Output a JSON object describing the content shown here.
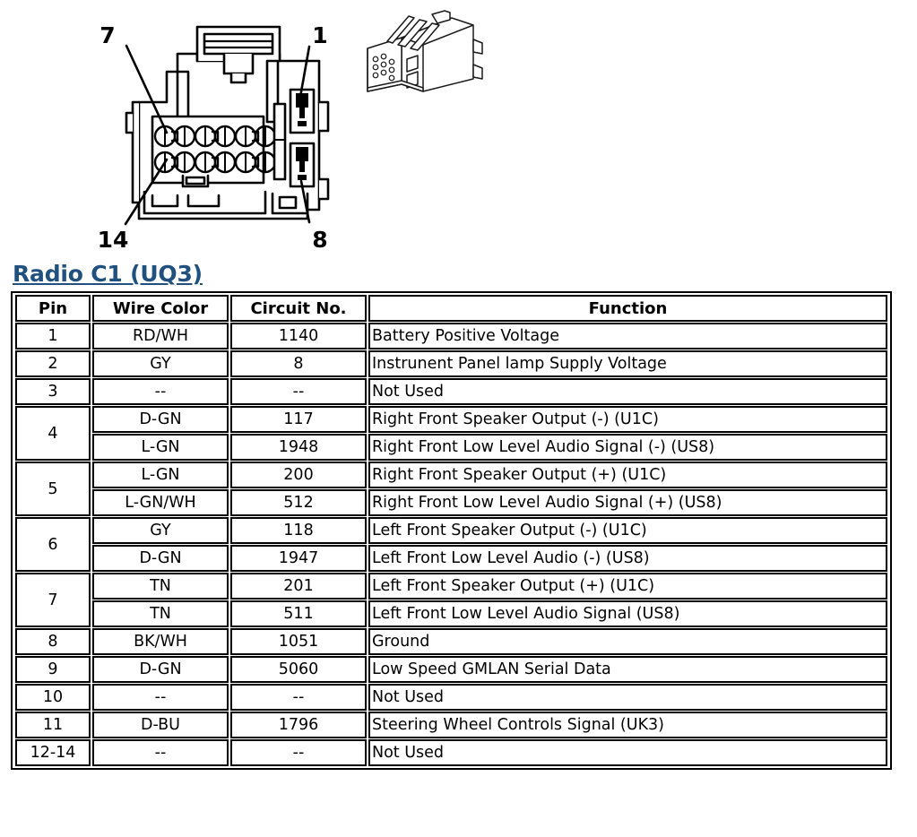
{
  "diagram": {
    "name": "radio-c1-connector-face-view",
    "description": "Front view of 14-cavity radio harness connector with pin-number callouts",
    "callouts": [
      {
        "label": "7",
        "position": "top-left"
      },
      {
        "label": "1",
        "position": "top-right"
      },
      {
        "label": "14",
        "position": "bottom-left"
      },
      {
        "label": "8",
        "position": "bottom-right"
      }
    ],
    "iso_view_name": "connector-isometric-view"
  },
  "heading": {
    "title": "Radio C1 (UQ3)",
    "color": "#20507d"
  },
  "table": {
    "name": "radio-c1-pinout-table",
    "headers": {
      "pin": "Pin",
      "wire_color": "Wire Color",
      "circuit_no": "Circuit No.",
      "function": "Function"
    },
    "rows": [
      {
        "pin": "1",
        "lines": [
          {
            "wire_color": "RD/WH",
            "circuit_no": "1140",
            "function": "Battery Positive Voltage"
          }
        ]
      },
      {
        "pin": "2",
        "lines": [
          {
            "wire_color": "GY",
            "circuit_no": "8",
            "function": "Instrunent Panel lamp Supply Voltage"
          }
        ]
      },
      {
        "pin": "3",
        "lines": [
          {
            "wire_color": "--",
            "circuit_no": "--",
            "function": "Not Used"
          }
        ]
      },
      {
        "pin": "4",
        "lines": [
          {
            "wire_color": "D-GN",
            "circuit_no": "117",
            "function": "Right Front Speaker Output (-) (U1C)"
          },
          {
            "wire_color": "L-GN",
            "circuit_no": "1948",
            "function": "Right Front Low Level Audio Signal (-) (US8)"
          }
        ]
      },
      {
        "pin": "5",
        "lines": [
          {
            "wire_color": "L-GN",
            "circuit_no": "200",
            "function": "Right Front Speaker Output (+) (U1C)"
          },
          {
            "wire_color": "L-GN/WH",
            "circuit_no": "512",
            "function": "Right Front Low Level Audio Signal (+) (US8)"
          }
        ]
      },
      {
        "pin": "6",
        "lines": [
          {
            "wire_color": "GY",
            "circuit_no": "118",
            "function": "Left Front Speaker Output (-) (U1C)"
          },
          {
            "wire_color": "D-GN",
            "circuit_no": "1947",
            "function": "Left Front Low Level Audio (-) (US8)"
          }
        ]
      },
      {
        "pin": "7",
        "lines": [
          {
            "wire_color": "TN",
            "circuit_no": "201",
            "function": "Left Front Speaker Output (+) (U1C)"
          },
          {
            "wire_color": "TN",
            "circuit_no": "511",
            "function": "Left Front Low Level Audio Signal (US8)"
          }
        ]
      },
      {
        "pin": "8",
        "lines": [
          {
            "wire_color": "BK/WH",
            "circuit_no": "1051",
            "function": "Ground"
          }
        ]
      },
      {
        "pin": "9",
        "lines": [
          {
            "wire_color": "D-GN",
            "circuit_no": "5060",
            "function": "Low Speed GMLAN Serial Data"
          }
        ]
      },
      {
        "pin": "10",
        "lines": [
          {
            "wire_color": "--",
            "circuit_no": "--",
            "function": "Not Used"
          }
        ]
      },
      {
        "pin": "11",
        "lines": [
          {
            "wire_color": "D-BU",
            "circuit_no": "1796",
            "function": "Steering Wheel Controls Signal (UK3)"
          }
        ]
      },
      {
        "pin": "12-14",
        "lines": [
          {
            "wire_color": "--",
            "circuit_no": "--",
            "function": "Not Used"
          }
        ]
      }
    ]
  }
}
